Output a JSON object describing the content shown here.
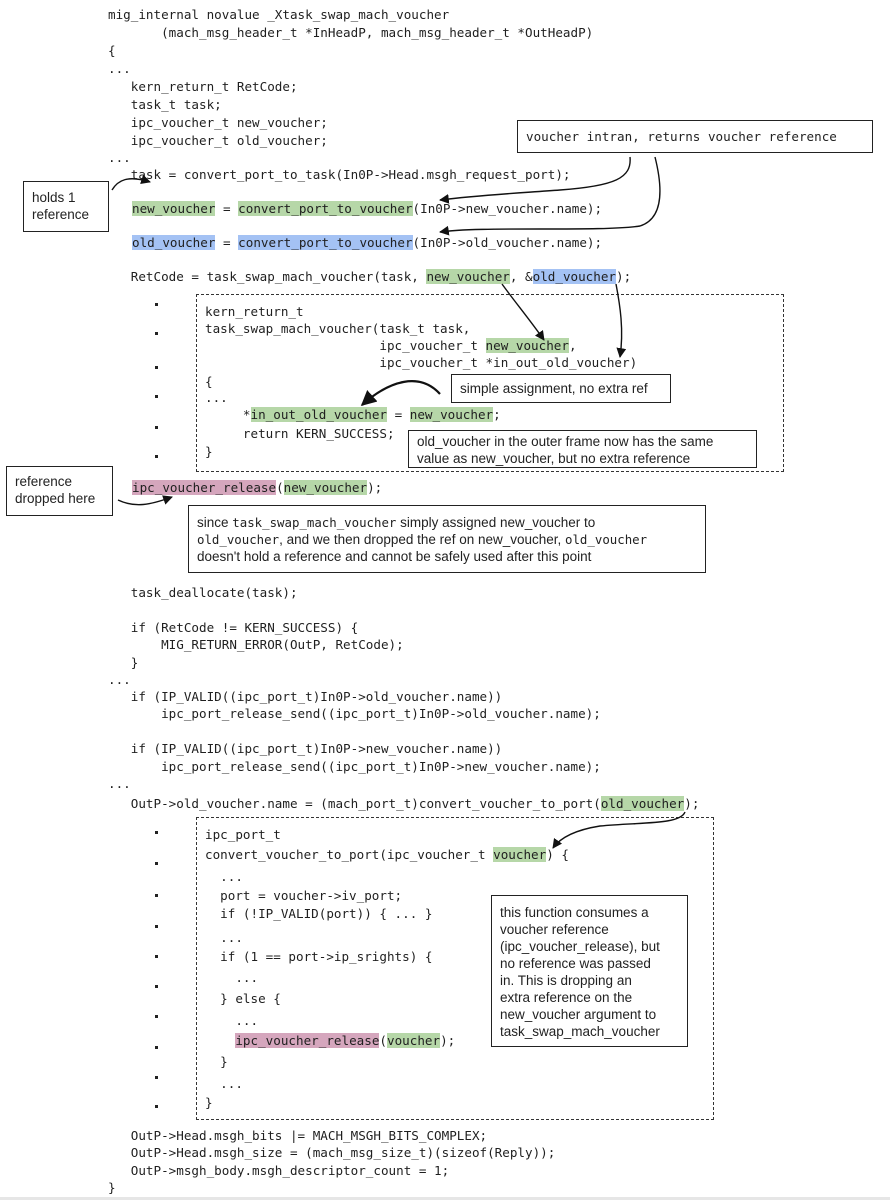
{
  "header": {
    "line1": "mig_internal novalue _Xtask_swap_mach_voucher",
    "line2": "       (mach_msg_header_t *InHeadP, mach_msg_header_t *OutHeadP)",
    "open_brace": "{",
    "ellipsis": "..."
  },
  "decls": [
    "   kern_return_t RetCode;",
    "   task_t task;",
    "   ipc_voucher_t new_voucher;",
    "   ipc_voucher_t old_voucher;"
  ],
  "ellipsis": "...",
  "task_line": "   task = convert_port_to_task(In0P->Head.msgh_request_port);",
  "new_voucher_line": {
    "lhs": "new_voucher",
    "eq": " = ",
    "fn": "convert_port_to_voucher",
    "args": "(In0P->new_voucher.name);"
  },
  "old_voucher_line": {
    "lhs": "old_voucher",
    "eq": " = ",
    "fn": "convert_port_to_voucher",
    "args": "(In0P->old_voucher.name);"
  },
  "retcode_line": {
    "prefix": "   RetCode = task_swap_mach_voucher(task, ",
    "arg1": "new_voucher",
    "sep": ", &",
    "arg2": "old_voucher",
    "suffix": ");"
  },
  "inner1": {
    "l1": "kern_return_t",
    "l2": "task_swap_mach_voucher(task_t task,",
    "l3_prefix": "                       ipc_voucher_t ",
    "l3_hl": "new_voucher",
    "l3_suffix": ",",
    "l4": "                       ipc_voucher_t *in_out_old_voucher)",
    "l5": "{",
    "l6": "...",
    "l7_prefix": "     *",
    "l7_hl1": "in_out_old_voucher",
    "l7_mid": " = ",
    "l7_hl2": "new_voucher",
    "l7_suffix": ";",
    "l8": "     return KERN_SUCCESS;",
    "l9": "}"
  },
  "release_line": {
    "fn": "ipc_voucher_release",
    "open": "(",
    "arg": "new_voucher",
    "close": ");"
  },
  "dealloc_line": "   task_deallocate(task);",
  "if_ret": [
    "   if (RetCode != KERN_SUCCESS) {",
    "       MIG_RETURN_ERROR(OutP, RetCode);",
    "   }"
  ],
  "if_old": [
    "   if (IP_VALID((ipc_port_t)In0P->old_voucher.name))",
    "       ipc_port_release_send((ipc_port_t)In0P->old_voucher.name);"
  ],
  "if_new": [
    "   if (IP_VALID((ipc_port_t)In0P->new_voucher.name))",
    "       ipc_port_release_send((ipc_port_t)In0P->new_voucher.name);"
  ],
  "outp_line": {
    "prefix": "   OutP->old_voucher.name = (mach_port_t)convert_voucher_to_port(",
    "arg": "old_voucher",
    "suffix": ");"
  },
  "inner2": {
    "l1": "ipc_port_t",
    "l2_prefix": "convert_voucher_to_port(ipc_voucher_t ",
    "l2_hl": "voucher",
    "l2_suffix": ") {",
    "l3": "  ...",
    "l4": "  port = voucher->iv_port;",
    "l5": "  if (!IP_VALID(port)) { ... }",
    "l6": "  ...",
    "l7": "  if (1 == port->ip_srights) {",
    "l8": "    ...",
    "l9": "  } else {",
    "l10": "    ...",
    "l11_indent": "    ",
    "l11_fn": "ipc_voucher_release",
    "l11_open": "(",
    "l11_arg": "voucher",
    "l11_close": ");",
    "l12": "  }",
    "l13": "  ...",
    "l14": "}"
  },
  "tail": [
    "   OutP->Head.msgh_bits |= MACH_MSGH_BITS_COMPLEX;",
    "   OutP->Head.msgh_size = (mach_msg_size_t)(sizeof(Reply));",
    "   OutP->msgh_body.msgh_descriptor_count = 1;"
  ],
  "close_brace": "}",
  "notes": {
    "intran": "voucher intran, returns voucher reference",
    "holds": [
      "holds 1",
      "reference"
    ],
    "simple": "simple assignment, no extra ref",
    "outer_frame": [
      "old_voucher in the outer frame now has the same",
      "value as new_voucher, but no extra reference"
    ],
    "dropped": [
      "reference",
      "dropped here"
    ],
    "since": {
      "p1": "since ",
      "m1": "task_swap_mach_voucher",
      "p2": " simply assigned new_voucher to",
      "m2": "old_voucher",
      "p3": ", and we then dropped the ref on new_voucher, ",
      "m3": "old_voucher",
      "p4": "doesn't hold a reference and cannot be safely used after this point"
    },
    "consumes": [
      "this function consumes a",
      "voucher reference",
      "(ipc_voucher_release), but",
      "no reference was passed",
      "in. This is dropping an",
      "extra reference on the",
      "new_voucher argument to",
      "task_swap_mach_voucher"
    ]
  },
  "colors": {
    "new_voucher_highlight": "#b6d7a8",
    "old_voucher_highlight": "#a4c2f4",
    "release_highlight": "#d5a6bd"
  }
}
